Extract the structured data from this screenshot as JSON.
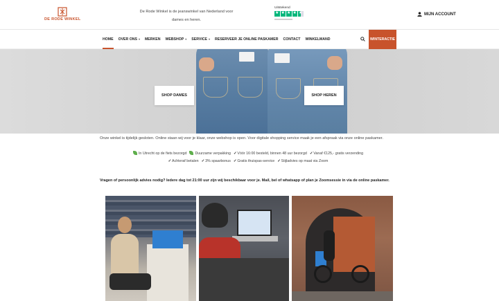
{
  "header": {
    "logo_text": "DE RODE WINKEL",
    "tagline": "De Rode Winkel is de jeanswinkel van Nederland voor dames en heren.",
    "trustpilot_label": "Uitstekend",
    "account_label": "MIJN ACCOUNT"
  },
  "nav": {
    "items": [
      {
        "label": "HOME",
        "dropdown": false
      },
      {
        "label": "OVER ONS",
        "dropdown": true
      },
      {
        "label": "MERKEN",
        "dropdown": false
      },
      {
        "label": "WEBSHOP",
        "dropdown": true
      },
      {
        "label": "SERVICE",
        "dropdown": true
      },
      {
        "label": "RESERVEER JE ONLINE PASKAMER",
        "dropdown": false
      },
      {
        "label": "CONTACT",
        "dropdown": false
      },
      {
        "label": "WINKELMAND",
        "dropdown": false
      }
    ],
    "winter_label": "WINTERACTIE"
  },
  "hero": {
    "btn_left": "SHOP DAMES",
    "btn_right": "SHOP HEREN"
  },
  "info_text": "Onze winkel is tijdelijk gesloten. Online staan wij voor je klaar, onze webshop is open. Voor digitale shopping service maak je een afspraak via onze online paskamer.",
  "usps": {
    "line1": [
      "In Utrecht op de fiets bezorgd",
      "Duurzame verpakking",
      "Vóór 16:00 besteld, binnen 48 uur bezorgd",
      "Vanaf €125,- gratis verzending"
    ],
    "line2": [
      "Achteraf betalen",
      "3% spaarbonus",
      "Gratis thuispas-service",
      "Stijladvies op maat via Zoom"
    ]
  },
  "advice": "Vragen of persoonlijk advies nodig? Iedere dag tot 21:00 uur zijn wij beschikbaar voor je. Mail, bel of whatsapp of plan je Zoomsessie in via de online paskamer.",
  "colors": {
    "brand": "#c8532c",
    "trustpilot": "#00b67a"
  }
}
